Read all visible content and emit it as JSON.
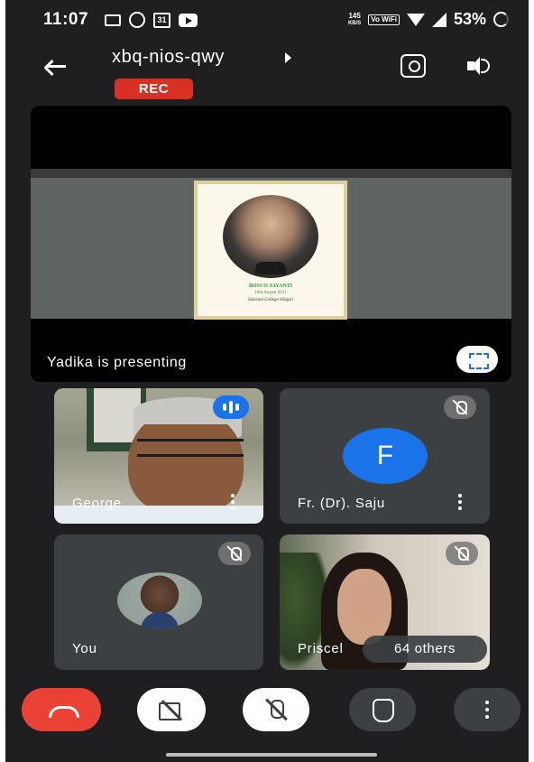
{
  "status_bar": {
    "time": "11:07",
    "calendar_day": "31",
    "net_speed_value": "145",
    "net_speed_unit": "KB/S",
    "volte_label": "Vo WiFi",
    "battery": "53%"
  },
  "header": {
    "meeting_code": "xbq-nios-qwy",
    "rec_label": "REC"
  },
  "presentation": {
    "card_line1": "BOSCO JAYANTI",
    "card_line2": "16th August 2021",
    "card_line3": "Salesian College Siliguri",
    "presenting_label": "Yadika  is presenting"
  },
  "participants": [
    {
      "name": "George",
      "speaking": true
    },
    {
      "name": "Fr. (Dr). Saju",
      "avatar_letter": "F",
      "muted": true
    },
    {
      "name": "You",
      "muted": true
    },
    {
      "name": "Priscel",
      "muted": true
    }
  ],
  "others_label": "64 others",
  "colors": {
    "accent": "#1a73e8",
    "end_call": "#ea4335",
    "rec": "#d93025",
    "background": "#1f1f21",
    "tile": "#3c4043"
  },
  "icons": {
    "back": "back-arrow-icon",
    "switch_camera": "switch-camera-icon",
    "speaker": "speaker-icon",
    "fullscreen": "fullscreen-icon",
    "end_call": "end-call-icon",
    "camera_off": "camera-off-icon",
    "mic_off": "mic-off-icon",
    "raise_hand": "raise-hand-icon",
    "more": "more-vert-icon"
  }
}
